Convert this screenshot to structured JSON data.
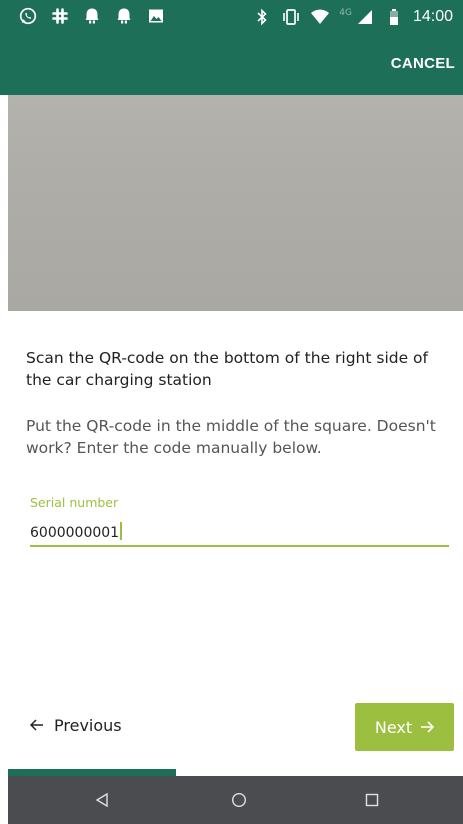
{
  "status_bar": {
    "left_icons": [
      "whatsapp-icon",
      "slack-icon",
      "notification-icon",
      "notification-icon",
      "image-icon"
    ],
    "right_icons": [
      "bluetooth-icon",
      "vibrate-icon",
      "wifi-icon",
      "signal-icon",
      "battery-icon"
    ],
    "network_type": "4G",
    "time": "14:00"
  },
  "app_bar": {
    "cancel_label": "CANCEL"
  },
  "instructions": {
    "title": "Scan the QR-code on the bottom of the right side of the car charging station",
    "body": "Put the QR-code in the middle of the square. Doesn't work? Enter the code manually below."
  },
  "serial_field": {
    "label": "Serial number",
    "value": "6000000001"
  },
  "navigation": {
    "previous_label": "Previous",
    "previous_icon": "arrow-left-icon",
    "next_label": "Next",
    "next_icon": "arrow-right-icon"
  },
  "progress": {
    "fraction": 0.37
  },
  "colors": {
    "primary": "#1e6f58",
    "accent": "#9cbf3f",
    "nav_bar": "#4a4c4f"
  }
}
